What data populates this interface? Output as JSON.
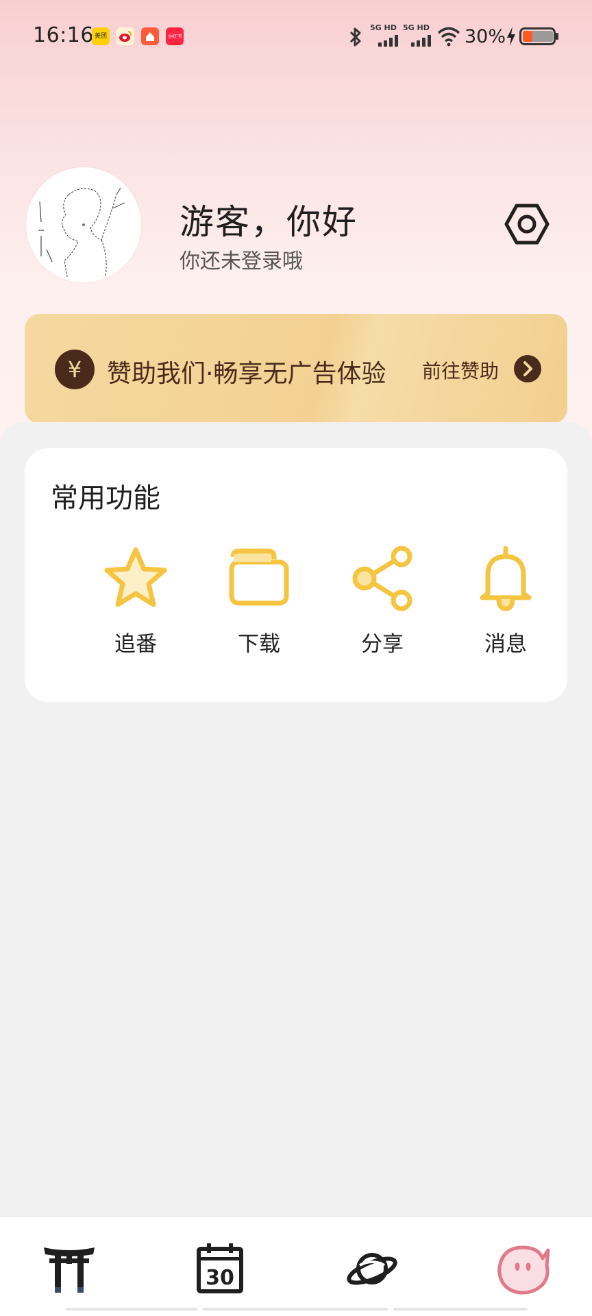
{
  "status_bar": {
    "time": "16:16",
    "apps": [
      {
        "name": "meituan-icon",
        "label": "美团",
        "color": "#ffd100"
      },
      {
        "name": "weibo-icon",
        "label": "",
        "color": "#f5a623"
      },
      {
        "name": "app-icon",
        "label": "",
        "color": "#ff5b3a"
      },
      {
        "name": "xiaohongshu-icon",
        "label": "小红书",
        "color": "#ff2442"
      }
    ],
    "network1": "5G HD",
    "network2": "5G HD",
    "battery": "30%"
  },
  "profile": {
    "greeting": "游客，你好",
    "login_hint": "你还未登录哦"
  },
  "sponsor": {
    "icon": "¥",
    "text": "赞助我们·畅享无广告体验",
    "cta": "前往赞助"
  },
  "common_functions": {
    "title": "常用功能",
    "items": [
      {
        "label": "追番",
        "icon": "star-icon"
      },
      {
        "label": "下载",
        "icon": "folder-icon"
      },
      {
        "label": "分享",
        "icon": "share-icon"
      },
      {
        "label": "消息",
        "icon": "bell-icon"
      }
    ]
  },
  "bottom_nav": [
    {
      "icon": "torii-gate-icon",
      "active": false
    },
    {
      "icon": "calendar-30-icon",
      "active": false
    },
    {
      "icon": "planet-icon",
      "active": false
    },
    {
      "icon": "mascot-face-icon",
      "active": true
    }
  ],
  "colors": {
    "accent": "#f5c542",
    "sponsor_dark": "#4a2b1b",
    "active_nav": "#e07a8a"
  }
}
